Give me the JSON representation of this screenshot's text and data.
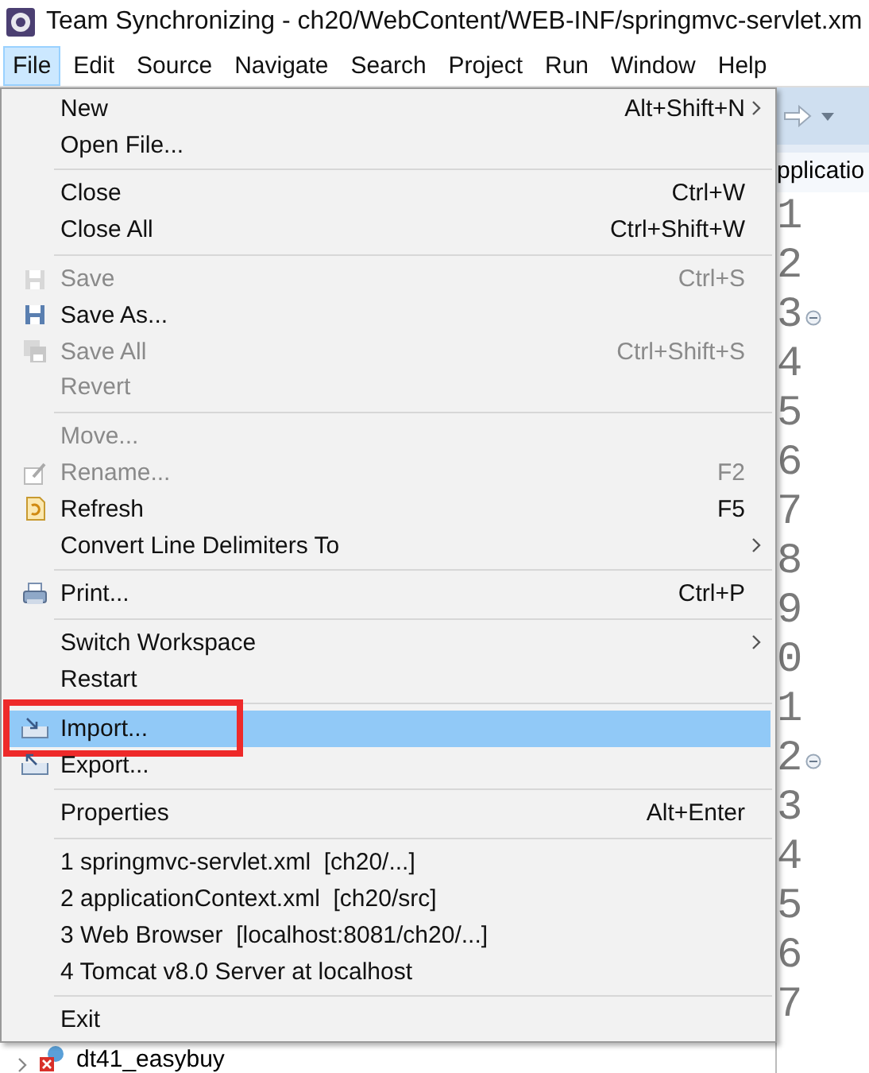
{
  "window": {
    "title": "Team Synchronizing - ch20/WebContent/WEB-INF/springmvc-servlet.xm"
  },
  "menu_bar": [
    {
      "label": "File",
      "selected": true
    },
    {
      "label": "Edit",
      "selected": false
    },
    {
      "label": "Source",
      "selected": false
    },
    {
      "label": "Navigate",
      "selected": false
    },
    {
      "label": "Search",
      "selected": false
    },
    {
      "label": "Project",
      "selected": false
    },
    {
      "label": "Run",
      "selected": false
    },
    {
      "label": "Window",
      "selected": false
    },
    {
      "label": "Help",
      "selected": false
    }
  ],
  "file_menu": [
    {
      "kind": "item",
      "label": "New",
      "shortcut": "Alt+Shift+N",
      "submenu": true,
      "disabled": false,
      "selected": false,
      "outlined": false
    },
    {
      "kind": "item",
      "label": "Open File...",
      "submenu": false,
      "disabled": false,
      "selected": false,
      "outlined": false
    },
    {
      "kind": "separator"
    },
    {
      "kind": "item",
      "label": "Close",
      "shortcut": "Ctrl+W",
      "submenu": false,
      "disabled": false,
      "selected": false,
      "outlined": false
    },
    {
      "kind": "item",
      "label": "Close All",
      "shortcut": "Ctrl+Shift+W",
      "submenu": false,
      "disabled": false,
      "selected": false,
      "outlined": false
    },
    {
      "kind": "separator"
    },
    {
      "kind": "item",
      "label": "Save",
      "shortcut": "Ctrl+S",
      "submenu": false,
      "disabled": true,
      "selected": false,
      "outlined": false
    },
    {
      "kind": "item",
      "label": "Save As...",
      "submenu": false,
      "disabled": false,
      "selected": false,
      "outlined": false
    },
    {
      "kind": "item",
      "label": "Save All",
      "shortcut": "Ctrl+Shift+S",
      "submenu": false,
      "disabled": true,
      "selected": false,
      "outlined": false
    },
    {
      "kind": "item",
      "label": "Revert",
      "submenu": false,
      "disabled": true,
      "selected": false,
      "outlined": false
    },
    {
      "kind": "separator"
    },
    {
      "kind": "item",
      "label": "Move...",
      "submenu": false,
      "disabled": true,
      "selected": false,
      "outlined": false
    },
    {
      "kind": "item",
      "label": "Rename...",
      "shortcut": "F2",
      "submenu": false,
      "disabled": true,
      "selected": false,
      "outlined": false
    },
    {
      "kind": "item",
      "label": "Refresh",
      "shortcut": "F5",
      "submenu": false,
      "disabled": false,
      "selected": false,
      "outlined": false
    },
    {
      "kind": "item",
      "label": "Convert Line Delimiters To",
      "submenu": true,
      "disabled": false,
      "selected": false,
      "outlined": false
    },
    {
      "kind": "separator"
    },
    {
      "kind": "item",
      "label": "Print...",
      "shortcut": "Ctrl+P",
      "submenu": false,
      "disabled": false,
      "selected": false,
      "outlined": false
    },
    {
      "kind": "separator"
    },
    {
      "kind": "item",
      "label": "Switch Workspace",
      "submenu": true,
      "disabled": false,
      "selected": false,
      "outlined": false
    },
    {
      "kind": "item",
      "label": "Restart",
      "submenu": false,
      "disabled": false,
      "selected": false,
      "outlined": false
    },
    {
      "kind": "separator"
    },
    {
      "kind": "item",
      "label": "Import...",
      "submenu": false,
      "disabled": false,
      "selected": true,
      "outlined": true
    },
    {
      "kind": "item",
      "label": "Export...",
      "submenu": false,
      "disabled": false,
      "selected": false,
      "outlined": false
    },
    {
      "kind": "separator"
    },
    {
      "kind": "item",
      "label": "Properties",
      "shortcut": "Alt+Enter",
      "submenu": false,
      "disabled": false,
      "selected": false,
      "outlined": false
    },
    {
      "kind": "separator"
    },
    {
      "kind": "item",
      "label": "1 springmvc-servlet.xml  [ch20/...]",
      "submenu": false,
      "disabled": false,
      "selected": false,
      "outlined": false
    },
    {
      "kind": "item",
      "label": "2 applicationContext.xml  [ch20/src]",
      "submenu": false,
      "disabled": false,
      "selected": false,
      "outlined": false
    },
    {
      "kind": "item",
      "label": "3 Web Browser  [localhost:8081/ch20/...]",
      "submenu": false,
      "disabled": false,
      "selected": false,
      "outlined": false
    },
    {
      "kind": "item",
      "label": "4 Tomcat v8.0 Server at localhost",
      "submenu": false,
      "disabled": false,
      "selected": false,
      "outlined": false
    },
    {
      "kind": "separator"
    },
    {
      "kind": "item",
      "label": "Exit",
      "submenu": false,
      "disabled": false,
      "selected": false,
      "outlined": false
    }
  ],
  "editor": {
    "tab": "pplicatio",
    "line_numbers": [
      {
        "text": "1",
        "folding": false
      },
      {
        "text": "2",
        "folding": false
      },
      {
        "text": "3",
        "folding": true
      },
      {
        "text": "4",
        "folding": false
      },
      {
        "text": "5",
        "folding": false
      },
      {
        "text": "6",
        "folding": false
      },
      {
        "text": "7",
        "folding": false
      },
      {
        "text": "8",
        "folding": false
      },
      {
        "text": "9",
        "folding": false
      },
      {
        "text": "0",
        "folding": false
      },
      {
        "text": "1",
        "folding": false
      },
      {
        "text": "2",
        "folding": true
      },
      {
        "text": "3",
        "folding": false
      },
      {
        "text": "4",
        "folding": false
      },
      {
        "text": "5",
        "folding": false
      },
      {
        "text": "6",
        "folding": false
      },
      {
        "text": "7",
        "folding": false
      }
    ]
  },
  "tree": {
    "label": "dt41_easybuy"
  }
}
